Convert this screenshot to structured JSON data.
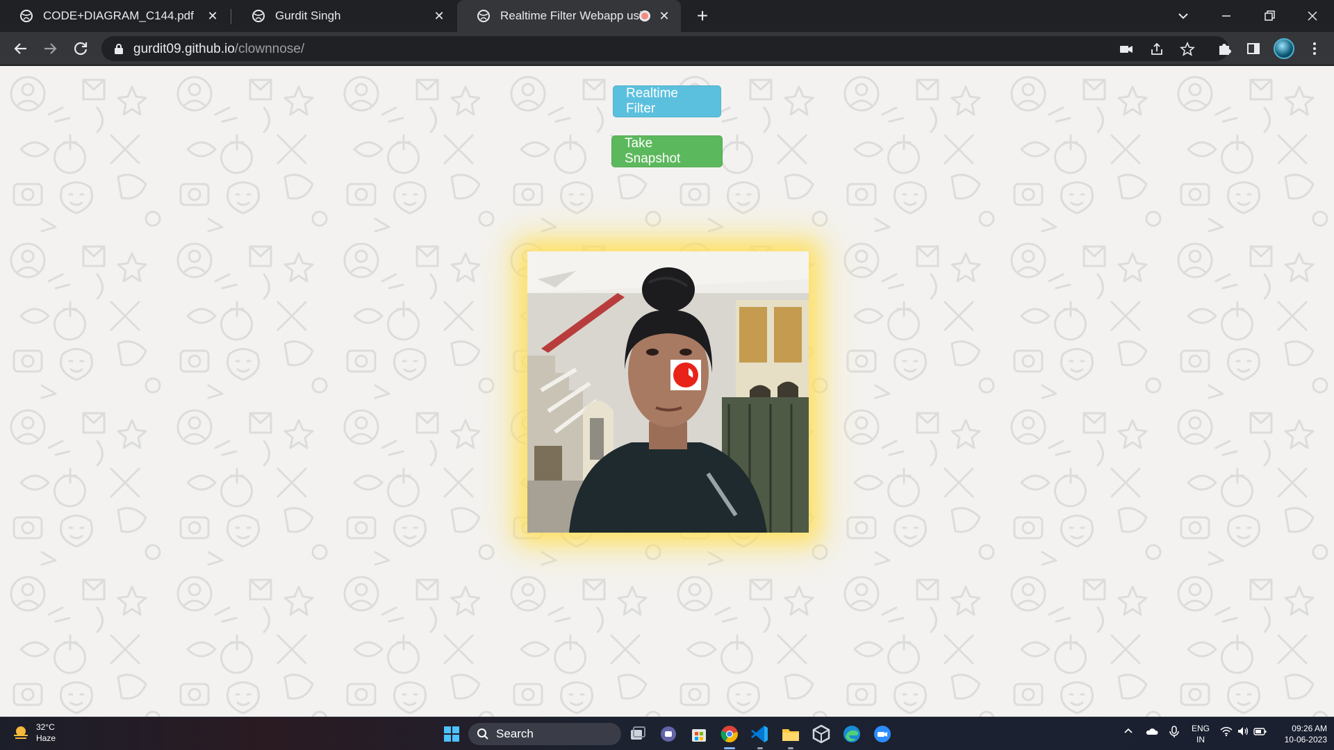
{
  "browser": {
    "tabs": [
      {
        "title": "CODE+DIAGRAM_C144.pdf",
        "close": "✕"
      },
      {
        "title": "Gurdit Singh",
        "close": "✕"
      },
      {
        "title": "Realtime Filter Webapp using",
        "close": "✕",
        "recording": true
      }
    ],
    "new_tab": "+",
    "url_host": "gurdit09.github.io",
    "url_path": "/clownnose/"
  },
  "page": {
    "filter_button": "Realtime Filter",
    "snapshot_button": "Take Snapshot",
    "colors": {
      "filter_button": "#5bc0de",
      "snapshot_button": "#5cb85c",
      "glow": "#ffdd50",
      "clown_nose": "#e8231a"
    }
  },
  "taskbar": {
    "weather_temp": "32°C",
    "weather_desc": "Haze",
    "search_label": "Search",
    "lang_line1": "ENG",
    "lang_line2": "IN",
    "time": "09:26 AM",
    "date": "10-06-2023",
    "apps": [
      "windows-start-icon",
      "task-view-icon",
      "teams-chat-icon",
      "microsoft-store-icon",
      "chrome-icon",
      "vscode-icon",
      "file-explorer-icon",
      "unity-icon",
      "edge-icon",
      "zoom-icon"
    ]
  }
}
